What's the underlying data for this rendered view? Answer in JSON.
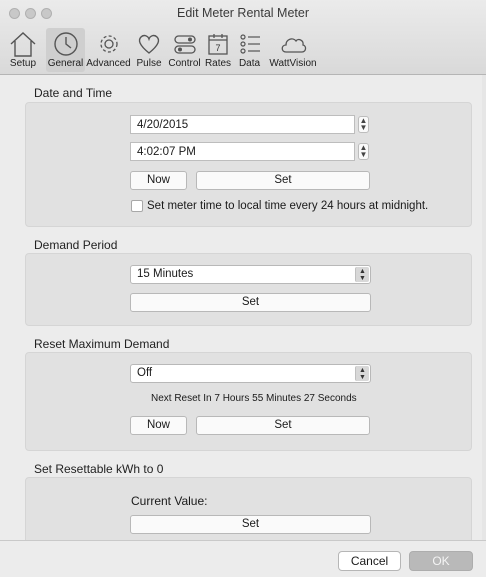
{
  "window": {
    "title": "Edit Meter Rental Meter"
  },
  "toolbar": {
    "items": [
      {
        "label": "Setup",
        "icon": "house-icon"
      },
      {
        "label": "General",
        "icon": "clock-icon",
        "selected": true
      },
      {
        "label": "Advanced",
        "icon": "gear-icon"
      },
      {
        "label": "Pulse",
        "icon": "heart-icon"
      },
      {
        "label": "Control",
        "icon": "toggle-icon"
      },
      {
        "label": "Rates",
        "icon": "calendar-icon"
      },
      {
        "label": "Data",
        "icon": "list-icon"
      },
      {
        "label": "WattVision",
        "icon": "cloud-icon"
      }
    ],
    "calendar_day": "7"
  },
  "date_time": {
    "title": "Date and Time",
    "date_value": "4/20/2015",
    "time_value": "4:02:07 PM",
    "now_label": "Now",
    "set_label": "Set",
    "checkbox_label": "Set meter time to local time every 24 hours at midnight.",
    "checkbox_checked": false
  },
  "demand_period": {
    "title": "Demand Period",
    "selected": "15 Minutes",
    "set_label": "Set"
  },
  "reset_max_demand": {
    "title": "Reset Maximum Demand",
    "selected": "Off",
    "next_reset": "Next Reset In 7 Hours 55 Minutes 27 Seconds",
    "now_label": "Now",
    "set_label": "Set"
  },
  "resettable_kwh": {
    "title": "Set Resettable kWh to 0",
    "current_value_label": "Current Value:",
    "set_label": "Set"
  },
  "footer": {
    "cancel_label": "Cancel",
    "ok_label": "OK"
  }
}
